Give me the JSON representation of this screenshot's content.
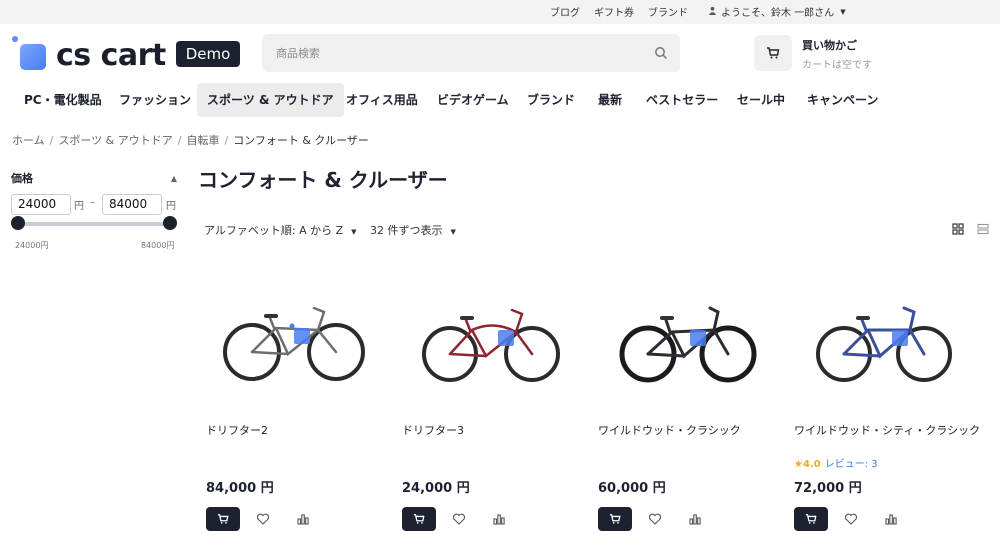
{
  "topbar": {
    "links": [
      "ブログ",
      "ギフト券",
      "ブランド"
    ],
    "user": "ようこそ、鈴木 一郎さん"
  },
  "header": {
    "logo": "cs cart",
    "demo_badge": "Demo",
    "search_placeholder": "商品検索",
    "cart_title": "買い物かご",
    "cart_status": "カートは空です"
  },
  "nav": [
    {
      "label": "PC・電化製品"
    },
    {
      "label": "ファッション"
    },
    {
      "label": "スポーツ & アウトドア",
      "active": true
    },
    {
      "label": "オフィス用品"
    },
    {
      "label": "ビデオゲーム"
    },
    {
      "label": "ブランド"
    },
    {
      "label": "最新"
    },
    {
      "label": "ベストセラー"
    },
    {
      "label": "セール中"
    },
    {
      "label": "キャンペーン"
    }
  ],
  "breadcrumb": [
    "ホーム",
    "スポーツ & アウトドア",
    "自転車",
    "コンフォート & クルーザー"
  ],
  "filter": {
    "title": "価格",
    "min": "24000",
    "max": "84000",
    "unit": "円",
    "dash": "–",
    "min_label": "24000円",
    "max_label": "84000円"
  },
  "page_title": "コンフォート & クルーザー",
  "sort": {
    "order": "アルファベット順: A から Z",
    "per_page": "32 件ずつ表示"
  },
  "products": [
    {
      "name": "ドリフター2",
      "price": "84,000 円",
      "frame_color": "#6d6f6b",
      "rating": null
    },
    {
      "name": "ドリフター3",
      "price": "24,000 円",
      "frame_color": "#8e2530",
      "rating": null
    },
    {
      "name": "ワイルドウッド・クラシック",
      "price": "60,000 円",
      "frame_color": "#2a2d34",
      "rating": null
    },
    {
      "name": "ワイルドウッド・シティ・クラシック",
      "price": "72,000 円",
      "frame_color": "#3e4f9a",
      "rating": {
        "value": "4.0",
        "reviews": "レビュー: 3"
      }
    }
  ],
  "colors": {
    "dark": "#1d2130",
    "accent_blue": "#4a7cf2",
    "star": "#f5a623",
    "link": "#3b7be0"
  }
}
